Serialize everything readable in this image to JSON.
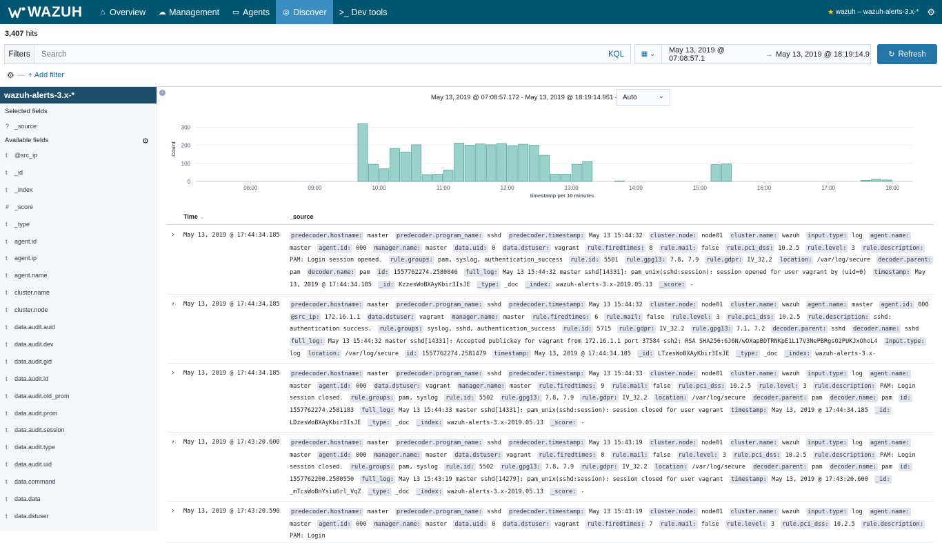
{
  "nav": {
    "brand": "WAZUH",
    "tabs": [
      {
        "label": "Overview",
        "icon": "home-icon"
      },
      {
        "label": "Management",
        "icon": "cloud-icon"
      },
      {
        "label": "Agents",
        "icon": "monitor-icon"
      },
      {
        "label": "Discover",
        "icon": "compass-icon"
      },
      {
        "label": ">_ Dev tools",
        "icon": "terminal-icon"
      }
    ],
    "active_tab": "Discover",
    "index_pattern": "wazuh – wazuh-alerts-3.x-*"
  },
  "hits": {
    "count": "3,407",
    "label": "hits"
  },
  "query": {
    "filters_label": "Filters",
    "placeholder": "Search",
    "language": "KQL",
    "add_filter": "+ Add filter"
  },
  "time": {
    "from": "May 13, 2019 @ 07:08:57.1",
    "arrow": "→",
    "to": "May 13, 2019 @ 18:19:14.9",
    "refresh_label": "Refresh"
  },
  "sidebar": {
    "index": "wazuh-alerts-3.x-*",
    "selected_title": "Selected fields",
    "selected": [
      {
        "type": "?",
        "name": "_source"
      }
    ],
    "available_title": "Available fields",
    "fields": [
      {
        "type": "t",
        "name": "@src_ip"
      },
      {
        "type": "t",
        "name": "_id"
      },
      {
        "type": "t",
        "name": "_index"
      },
      {
        "type": "#",
        "name": "_score"
      },
      {
        "type": "t",
        "name": "_type"
      },
      {
        "type": "t",
        "name": "agent.id"
      },
      {
        "type": "t",
        "name": "agent.ip"
      },
      {
        "type": "t",
        "name": "agent.name"
      },
      {
        "type": "t",
        "name": "cluster.name"
      },
      {
        "type": "t",
        "name": "cluster.node"
      },
      {
        "type": "t",
        "name": "data.audit.auid"
      },
      {
        "type": "t",
        "name": "data.audit.dev"
      },
      {
        "type": "t",
        "name": "data.audit.gid"
      },
      {
        "type": "t",
        "name": "data.audit.id"
      },
      {
        "type": "t",
        "name": "data.audit.old_prom"
      },
      {
        "type": "t",
        "name": "data.audit.prom"
      },
      {
        "type": "t",
        "name": "data.audit.session"
      },
      {
        "type": "t",
        "name": "data.audit.type"
      },
      {
        "type": "t",
        "name": "data.audit.uid"
      },
      {
        "type": "t",
        "name": "data.command"
      },
      {
        "type": "t",
        "name": "data.data"
      },
      {
        "type": "t",
        "name": "data.dstuser"
      }
    ]
  },
  "chart_header": {
    "range": "May 13, 2019 @ 07:08:57.172 - May 13, 2019 @ 18:19:14.951 —",
    "interval": "Auto"
  },
  "chart_data": {
    "type": "bar",
    "xlabel": "timestamp per 10 minutes",
    "ylabel": "Count",
    "ylim": [
      0,
      340
    ],
    "yticks": [
      0,
      100,
      200,
      300
    ],
    "xticks": [
      "08:00",
      "09:00",
      "10:00",
      "11:00",
      "12:00",
      "13:00",
      "14:00",
      "15:00",
      "16:00",
      "17:00",
      "18:00"
    ],
    "xrange_hours": [
      7.148,
      18.32
    ],
    "bars": [
      {
        "t": "09:40",
        "value": 320
      },
      {
        "t": "09:50",
        "value": 95
      },
      {
        "t": "10:00",
        "value": 70
      },
      {
        "t": "10:10",
        "value": 183
      },
      {
        "t": "10:20",
        "value": 163
      },
      {
        "t": "10:30",
        "value": 203
      },
      {
        "t": "10:40",
        "value": 38
      },
      {
        "t": "10:50",
        "value": 40
      },
      {
        "t": "11:00",
        "value": 63
      },
      {
        "t": "11:10",
        "value": 212
      },
      {
        "t": "11:20",
        "value": 200
      },
      {
        "t": "11:30",
        "value": 208
      },
      {
        "t": "11:40",
        "value": 203
      },
      {
        "t": "11:50",
        "value": 210
      },
      {
        "t": "12:00",
        "value": 198
      },
      {
        "t": "12:10",
        "value": 206
      },
      {
        "t": "12:20",
        "value": 200
      },
      {
        "t": "12:30",
        "value": 145
      },
      {
        "t": "12:40",
        "value": 40
      },
      {
        "t": "12:50",
        "value": 40
      },
      {
        "t": "13:00",
        "value": 95
      },
      {
        "t": "13:10",
        "value": 110
      },
      {
        "t": "13:40",
        "value": 3
      },
      {
        "t": "15:10",
        "value": 93
      },
      {
        "t": "15:20",
        "value": 97
      },
      {
        "t": "17:30",
        "value": 6
      },
      {
        "t": "17:40",
        "value": 12
      },
      {
        "t": "17:50",
        "value": 8
      }
    ]
  },
  "table": {
    "col_time": "Time",
    "col_source": "_source",
    "rows": [
      {
        "time": "May 13, 2019 @ 17:44:34.185",
        "fields": [
          [
            "predecoder.hostname:",
            "master"
          ],
          [
            "predecoder.program_name:",
            "sshd"
          ],
          [
            "predecoder.timestamp:",
            "May 13 15:44:32"
          ],
          [
            "cluster.node:",
            "node01"
          ],
          [
            "cluster.name:",
            "wazuh"
          ],
          [
            "input.type:",
            "log"
          ],
          [
            "agent.name:",
            "master"
          ],
          [
            "agent.id:",
            "000"
          ],
          [
            "manager.name:",
            "master"
          ],
          [
            "data.uid:",
            "0"
          ],
          [
            "data.dstuser:",
            "vagrant"
          ],
          [
            "rule.firedtimes:",
            "8"
          ],
          [
            "rule.mail:",
            "false"
          ],
          [
            "rule.pci_dss:",
            "10.2.5"
          ],
          [
            "rule.level:",
            "3"
          ],
          [
            "rule.description:",
            "PAM: Login session opened."
          ],
          [
            "rule.groups:",
            "pam, syslog, authentication_success"
          ],
          [
            "rule.id:",
            "5501"
          ],
          [
            "rule.gpg13:",
            "7.8, 7.9"
          ],
          [
            "rule.gdpr:",
            "IV_32.2"
          ],
          [
            "location:",
            "/var/log/secure"
          ],
          [
            "decoder.parent:",
            "pam"
          ],
          [
            "decoder.name:",
            "pam"
          ],
          [
            "id:",
            "1557762274.2580846"
          ],
          [
            "full_log:",
            "May 13 15:44:32 master sshd[14331]: pam_unix(sshd:session): session opened for user vagrant by (uid=0)"
          ],
          [
            "timestamp:",
            "May 13, 2019 @ 17:44:34.185"
          ],
          [
            "_id:",
            "KzzesWoBXAyKbir3IsJE"
          ],
          [
            "_type:",
            "_doc"
          ],
          [
            "_index:",
            "wazuh-alerts-3.x-2019.05.13"
          ],
          [
            "_score:",
            "-"
          ]
        ]
      },
      {
        "time": "May 13, 2019 @ 17:44:34.185",
        "fields": [
          [
            "predecoder.hostname:",
            "master"
          ],
          [
            "predecoder.program_name:",
            "sshd"
          ],
          [
            "predecoder.timestamp:",
            "May 13 15:44:32"
          ],
          [
            "cluster.node:",
            "node01"
          ],
          [
            "cluster.name:",
            "wazuh"
          ],
          [
            "agent.name:",
            "master"
          ],
          [
            "agent.id:",
            "000"
          ],
          [
            "@src_ip:",
            "172.16.1.1"
          ],
          [
            "data.dstuser:",
            "vagrant"
          ],
          [
            "manager.name:",
            "master"
          ],
          [
            "rule.firedtimes:",
            "6"
          ],
          [
            "rule.mail:",
            "false"
          ],
          [
            "rule.level:",
            "3"
          ],
          [
            "rule.pci_dss:",
            "10.2.5"
          ],
          [
            "rule.description:",
            "sshd: authentication success."
          ],
          [
            "rule.groups:",
            "syslog, sshd, authentication_success"
          ],
          [
            "rule.id:",
            "5715"
          ],
          [
            "rule.gdpr:",
            "IV_32.2"
          ],
          [
            "rule.gpg13:",
            "7.1, 7.2"
          ],
          [
            "decoder.parent:",
            "sshd"
          ],
          [
            "decoder.name:",
            "sshd"
          ],
          [
            "full_log:",
            "May 13 15:44:32 master sshd[14331]: Accepted publickey for vagrant from 172.16.1.1 port 37584 ssh2: RSA SHA256:6J6N/wOXapBDTRNKpE1L17V3NePBRgsO2PUKJxOhoL4"
          ],
          [
            "input.type:",
            "log"
          ],
          [
            "location:",
            "/var/log/secure"
          ],
          [
            "id:",
            "1557762274.2581479"
          ],
          [
            "timestamp:",
            "May 13, 2019 @ 17:44:34.185"
          ],
          [
            "_id:",
            "LTzesWoBXAyKbir3IsJE"
          ],
          [
            "_type:",
            "_doc"
          ],
          [
            "_index:",
            "wazuh-alerts-3.x-"
          ]
        ]
      },
      {
        "time": "May 13, 2019 @ 17:44:34.185",
        "fields": [
          [
            "predecoder.hostname:",
            "master"
          ],
          [
            "predecoder.program_name:",
            "sshd"
          ],
          [
            "predecoder.timestamp:",
            "May 13 15:44:33"
          ],
          [
            "cluster.node:",
            "node01"
          ],
          [
            "cluster.name:",
            "wazuh"
          ],
          [
            "input.type:",
            "log"
          ],
          [
            "agent.name:",
            "master"
          ],
          [
            "agent.id:",
            "000"
          ],
          [
            "data.dstuser:",
            "vagrant"
          ],
          [
            "manager.name:",
            "master"
          ],
          [
            "rule.firedtimes:",
            "9"
          ],
          [
            "rule.mail:",
            "false"
          ],
          [
            "rule.pci_dss:",
            "10.2.5"
          ],
          [
            "rule.level:",
            "3"
          ],
          [
            "rule.description:",
            "PAM: Login session closed."
          ],
          [
            "rule.groups:",
            "pam, syslog"
          ],
          [
            "rule.id:",
            "5502"
          ],
          [
            "rule.gpg13:",
            "7.8, 7.9"
          ],
          [
            "rule.gdpr:",
            "IV_32.2"
          ],
          [
            "location:",
            "/var/log/secure"
          ],
          [
            "decoder.parent:",
            "pam"
          ],
          [
            "decoder.name:",
            "pam"
          ],
          [
            "id:",
            "1557762274.2581183"
          ],
          [
            "full_log:",
            "May 13 15:44:33 master sshd[14331]: pam_unix(sshd:session): session closed for user vagrant"
          ],
          [
            "timestamp:",
            "May 13, 2019 @ 17:44:34.185"
          ],
          [
            "_id:",
            "LDzesWoBXAyKbir3IsJE"
          ],
          [
            "_type:",
            "_doc"
          ],
          [
            "_index:",
            "wazuh-alerts-3.x-2019.05.13"
          ],
          [
            "_score:",
            "-"
          ]
        ]
      },
      {
        "time": "May 13, 2019 @ 17:43:20.600",
        "fields": [
          [
            "predecoder.hostname:",
            "master"
          ],
          [
            "predecoder.program_name:",
            "sshd"
          ],
          [
            "predecoder.timestamp:",
            "May 13 15:43:19"
          ],
          [
            "cluster.node:",
            "node01"
          ],
          [
            "cluster.name:",
            "wazuh"
          ],
          [
            "input.type:",
            "log"
          ],
          [
            "agent.name:",
            "master"
          ],
          [
            "agent.id:",
            "000"
          ],
          [
            "manager.name:",
            "master"
          ],
          [
            "data.dstuser:",
            "vagrant"
          ],
          [
            "rule.firedtimes:",
            "8"
          ],
          [
            "rule.mail:",
            "false"
          ],
          [
            "rule.level:",
            "3"
          ],
          [
            "rule.pci_dss:",
            "10.2.5"
          ],
          [
            "rule.description:",
            "PAM: Login session closed."
          ],
          [
            "rule.groups:",
            "pam, syslog"
          ],
          [
            "rule.id:",
            "5502"
          ],
          [
            "rule.gpg13:",
            "7.8, 7.9"
          ],
          [
            "rule.gdpr:",
            "IV_32.2"
          ],
          [
            "location:",
            "/var/log/secure"
          ],
          [
            "decoder.parent:",
            "pam"
          ],
          [
            "decoder.name:",
            "pam"
          ],
          [
            "id:",
            "1557762200.2580550"
          ],
          [
            "full_log:",
            "May 13 15:43:19 master sshd[14279]: pam_unix(sshd:session): session closed for user vagrant"
          ],
          [
            "timestamp:",
            "May 13, 2019 @ 17:43:20.600"
          ],
          [
            "_id:",
            "_mTcsWoBnYsiu6rl_VqZ"
          ],
          [
            "_type:",
            "_doc"
          ],
          [
            "_index:",
            "wazuh-alerts-3.x-2019.05.13"
          ],
          [
            "_score:",
            "-"
          ]
        ]
      },
      {
        "time": "May 13, 2019 @ 17:43:20.590",
        "fields": [
          [
            "predecoder.hostname:",
            "master"
          ],
          [
            "predecoder.program_name:",
            "sshd"
          ],
          [
            "predecoder.timestamp:",
            "May 13 15:43:19"
          ],
          [
            "cluster.node:",
            "node01"
          ],
          [
            "cluster.name:",
            "wazuh"
          ],
          [
            "input.type:",
            "log"
          ],
          [
            "agent.name:",
            "master"
          ],
          [
            "agent.id:",
            "000"
          ],
          [
            "manager.name:",
            "master"
          ],
          [
            "data.uid:",
            "0"
          ],
          [
            "data.dstuser:",
            "vagrant"
          ],
          [
            "rule.firedtimes:",
            "7"
          ],
          [
            "rule.mail:",
            "false"
          ],
          [
            "rule.level:",
            "3"
          ],
          [
            "rule.pci_dss:",
            "10.2.5"
          ],
          [
            "rule.description:",
            "PAM: Login"
          ]
        ]
      }
    ]
  },
  "colors": {
    "nav_bg": "#005571",
    "nav_active": "#3a8fc0",
    "bar_fill": "#9ad1c9",
    "bar_stroke": "#54a89b",
    "accent": "#006bb4"
  }
}
